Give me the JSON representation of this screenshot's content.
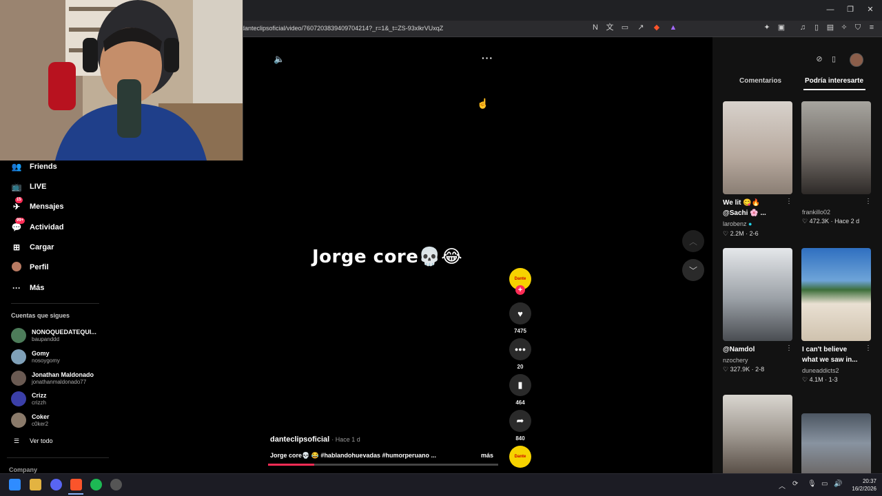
{
  "browser": {
    "url": "danteclipsoficial/video/7607203839409704214?_r=1&_t=ZS-93xlkrVUxqZ"
  },
  "sidebar": {
    "nav": [
      {
        "label": "Friends",
        "icon": "friends-icon"
      },
      {
        "label": "LIVE",
        "icon": "live-icon"
      },
      {
        "label": "Mensajes",
        "icon": "messages-icon",
        "badge": "15"
      },
      {
        "label": "Actividad",
        "icon": "activity-icon",
        "badge": "99+"
      },
      {
        "label": "Cargar",
        "icon": "upload-icon"
      },
      {
        "label": "Perfil",
        "icon": "profile-avatar"
      },
      {
        "label": "Más",
        "icon": "more-icon"
      }
    ],
    "following_title": "Cuentas que sigues",
    "following": [
      {
        "name": "NONOQUEDATEQUI...",
        "handle": "baupanddd"
      },
      {
        "name": "Gomy",
        "handle": "nosoygomy"
      },
      {
        "name": "Jonathan Maldonado",
        "handle": "jonathanmaldonado77"
      },
      {
        "name": "Crizz",
        "handle": "crizzh"
      },
      {
        "name": "Coker",
        "handle": "c0ker2"
      }
    ],
    "see_all": "Ver todo",
    "company": "Company"
  },
  "video": {
    "overlay_text": "Jorge core💀😂",
    "author": "danteclipsoficial",
    "time_ago": "Hace 1 d",
    "description": "Jorge core💀 😂 #hablandohuevadas #humorperuano ...",
    "more_label": "más",
    "likes": "7475",
    "comments": "20",
    "saves": "464",
    "shares": "840",
    "progress": 0.2
  },
  "right_panel": {
    "tabs": [
      "Comentarios",
      "Podría interesarte"
    ],
    "active_tab": 1,
    "cards": [
      {
        "title": "We lit 😋🔥 @Sachi 🌸 ...",
        "user": "larobenz",
        "verified": true,
        "likes": "2.2M",
        "date": "2-6"
      },
      {
        "title": "",
        "user": "frankillo02",
        "verified": false,
        "likes": "472.3K",
        "date": "Hace 2 d"
      },
      {
        "title": "@Namdol",
        "user": "nzochery",
        "verified": false,
        "likes": "327.9K",
        "date": "2-8"
      },
      {
        "title": "I can't believe what we saw in...",
        "user": "duneaddicts2",
        "verified": false,
        "likes": "4.1M",
        "date": "1-3"
      }
    ]
  },
  "taskbar": {
    "time": "20:37",
    "date": "16/2/2026"
  },
  "colors": {
    "accent": "#fe2c55",
    "background": "#000000",
    "panel": "#121212"
  }
}
